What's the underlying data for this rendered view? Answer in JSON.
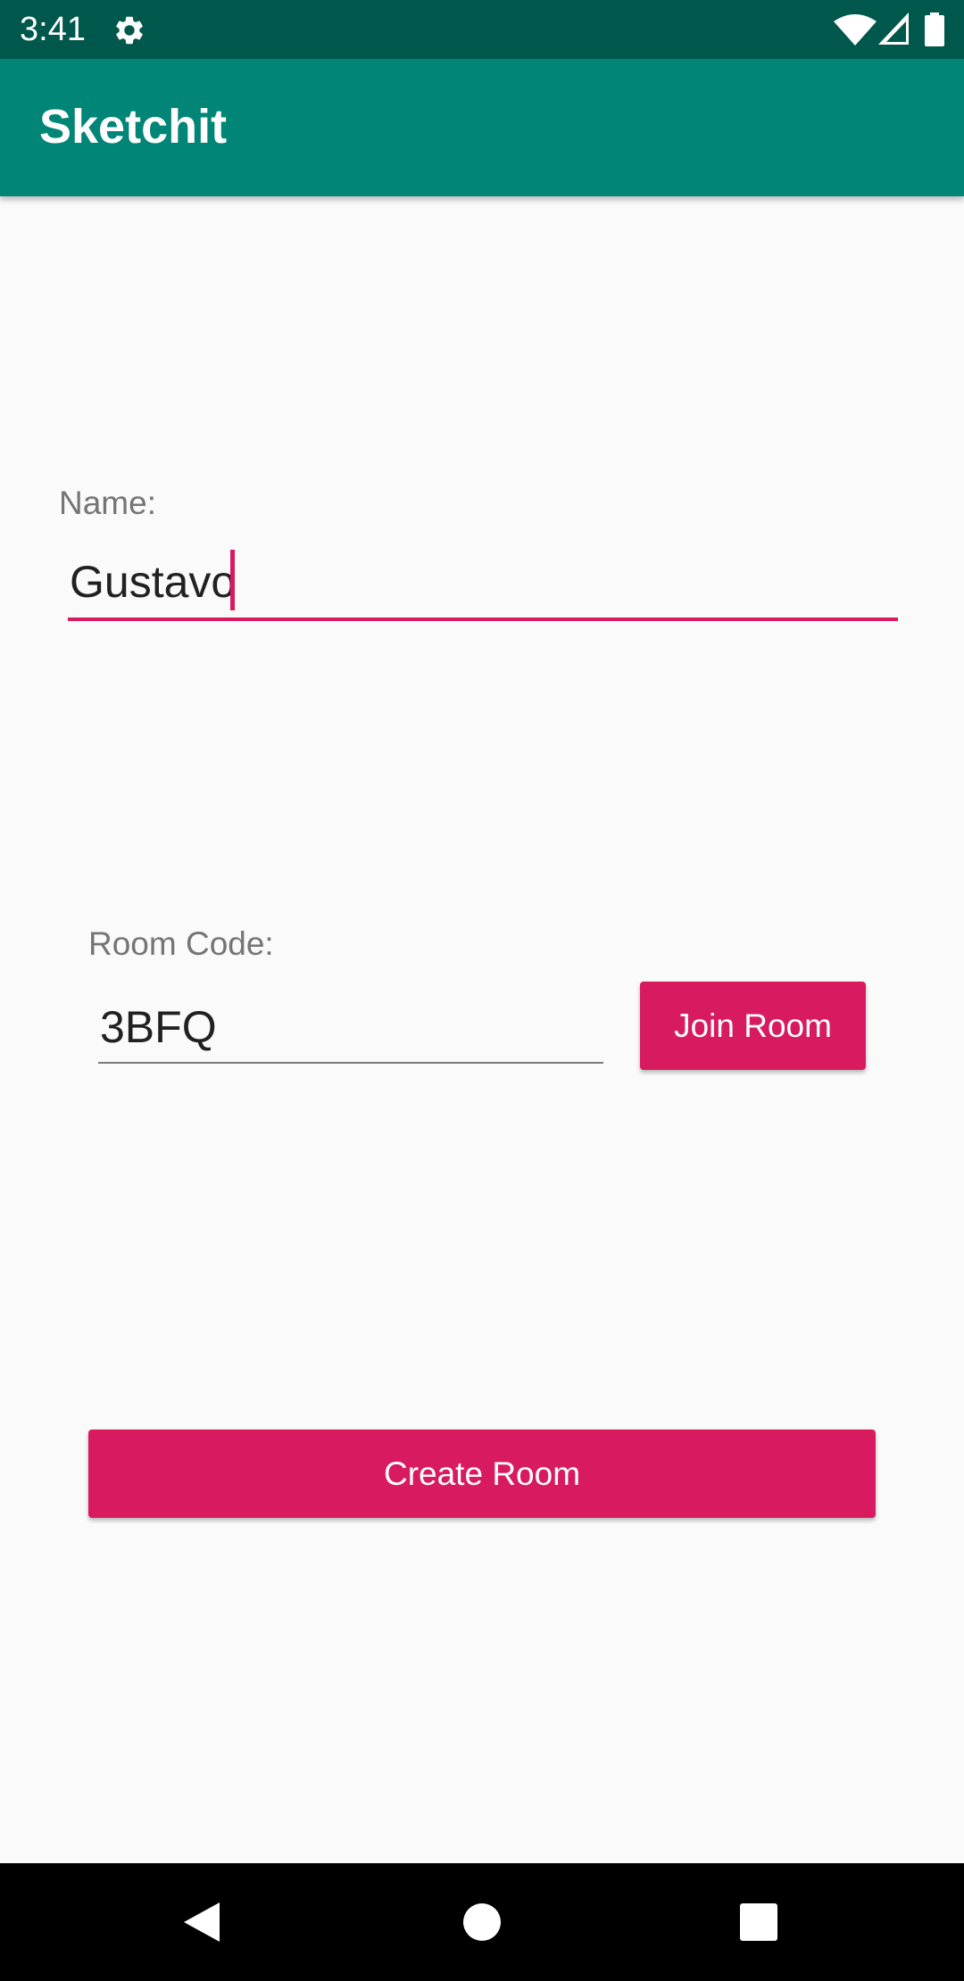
{
  "status_bar": {
    "time": "3:41",
    "icons": [
      "settings-gear-icon",
      "wifi-icon",
      "cell-signal-icon",
      "battery-icon"
    ]
  },
  "app_bar": {
    "title": "Sketchit",
    "color": "#008577"
  },
  "form": {
    "name_label": "Name:",
    "name_value": "Gustavo",
    "room_label": "Room Code:",
    "room_value": "3BFQ",
    "join_button_label": "Join Room",
    "create_button_label": "Create Room"
  },
  "nav_bar": {
    "buttons": [
      "back-icon",
      "home-icon",
      "recents-icon"
    ]
  },
  "colors": {
    "accent": "#D81B60",
    "primary": "#008577",
    "primary_dark": "#00574B"
  }
}
